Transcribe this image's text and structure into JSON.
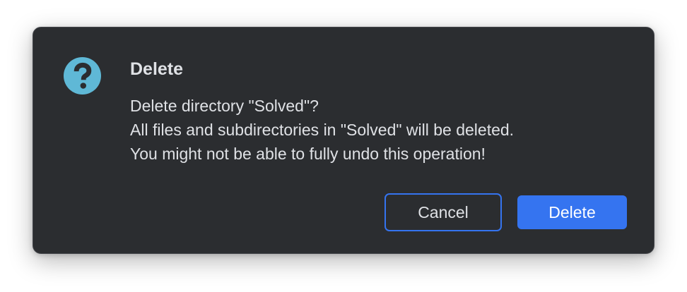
{
  "dialog": {
    "icon": "question-icon",
    "title": "Delete",
    "message_lines": [
      "Delete directory \"Solved\"?",
      "All files and subdirectories in \"Solved\" will be deleted.",
      "You might not be able to fully undo this operation!"
    ],
    "buttons": {
      "cancel_label": "Cancel",
      "delete_label": "Delete"
    },
    "colors": {
      "background": "#2b2d30",
      "accent": "#3574f0",
      "icon": "#5fb8d6",
      "text": "#dfe1e5"
    }
  }
}
